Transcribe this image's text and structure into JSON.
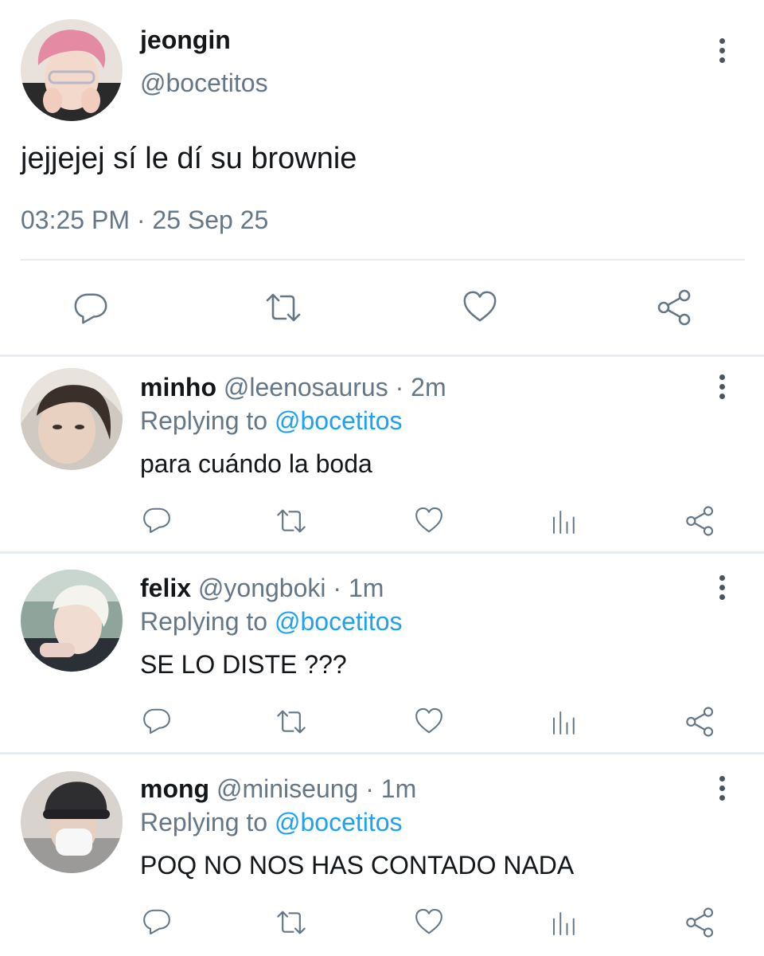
{
  "main_tweet": {
    "display_name": "jeongin",
    "handle": "@bocetitos",
    "text": "jejjejej sí le dí su brownie",
    "time": "03:25 PM",
    "dot": "·",
    "date": "25 Sep 25",
    "actions": [
      "reply-icon",
      "retweet-icon",
      "like-icon",
      "share-icon"
    ]
  },
  "replies": [
    {
      "display_name": "minho",
      "handle": "@leenosaurus",
      "time_sep": "·",
      "time": "2m",
      "replying_prefix": "Replying to",
      "replying_handle": "@bocetitos",
      "text": "para cuándo la boda",
      "actions": [
        "reply-icon",
        "retweet-icon",
        "like-icon",
        "analytics-icon",
        "share-icon"
      ]
    },
    {
      "display_name": "felix",
      "handle": "@yongboki",
      "time_sep": "·",
      "time": "1m",
      "replying_prefix": "Replying to",
      "replying_handle": "@bocetitos",
      "text": "SE LO DISTE ???",
      "actions": [
        "reply-icon",
        "retweet-icon",
        "like-icon",
        "analytics-icon",
        "share-icon"
      ]
    },
    {
      "display_name": "mong",
      "handle": "@miniseung",
      "time_sep": "·",
      "time": "1m",
      "replying_prefix": "Replying to",
      "replying_handle": "@bocetitos",
      "text": "POQ NO NOS HAS CONTADO NADA",
      "actions": [
        "reply-icon",
        "retweet-icon",
        "like-icon",
        "analytics-icon",
        "share-icon"
      ]
    }
  ],
  "colors": {
    "text": "#14171a",
    "secondary": "#657786",
    "link": "#1da1f2",
    "divider": "#e6ecf0"
  }
}
